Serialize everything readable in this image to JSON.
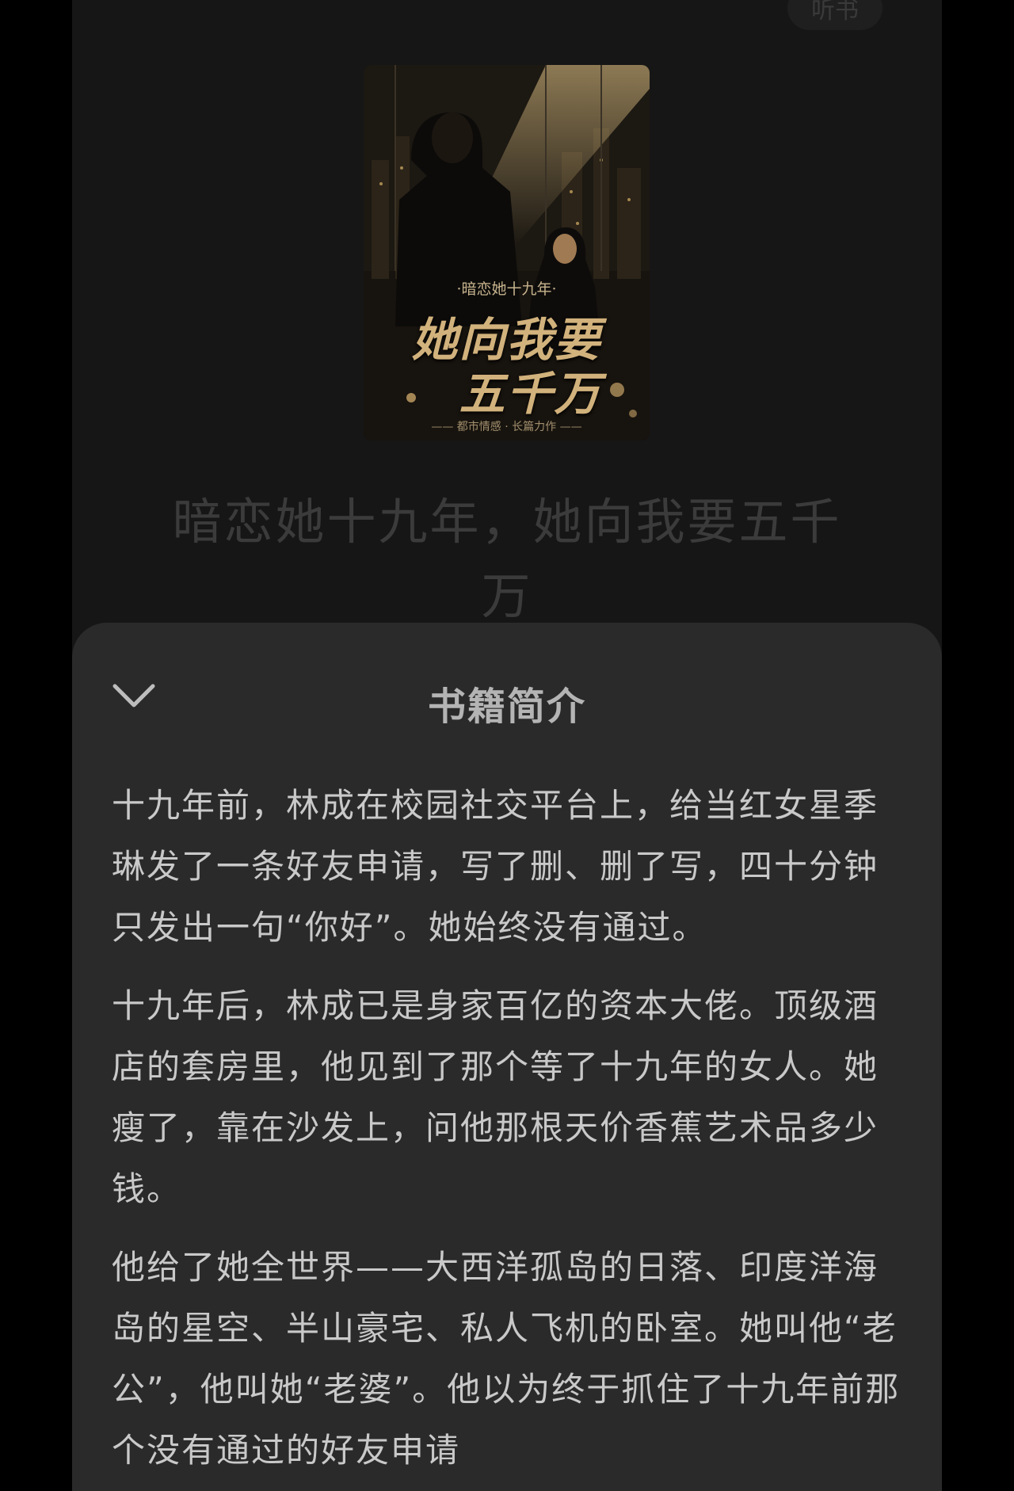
{
  "top_bar": {
    "listen_label": "听书"
  },
  "cover": {
    "subtitle": "·暗恋她十九年·",
    "title_line1": "她向我要",
    "title_line2": "五千万",
    "footer": "—— 都市情感 · 长篇力作 ——"
  },
  "book": {
    "title": "暗恋她十九年，她向我要五千万"
  },
  "intro_sheet": {
    "title": "书籍简介",
    "paragraphs": [
      "十九年前，林成在校园社交平台上，给当红女星季琳发了一条好友申请，写了删、删了写，四十分钟只发出一句“你好”。她始终没有通过。",
      "十九年后，林成已是身家百亿的资本大佬。顶级酒店的套房里，他见到了那个等了十九年的女人。她瘦了，靠在沙发上，问他那根天价香蕉艺术品多少钱。",
      "他给了她全世界——大西洋孤岛的日落、印度洋海岛的星空、半山豪宅、私人飞机的卧室。她叫他“老公”，他叫她“老婆”。他以为终于抓住了十九年前那个没有通过的好友申请"
    ]
  },
  "icons": {
    "collapse": "chevron-down-icon"
  }
}
